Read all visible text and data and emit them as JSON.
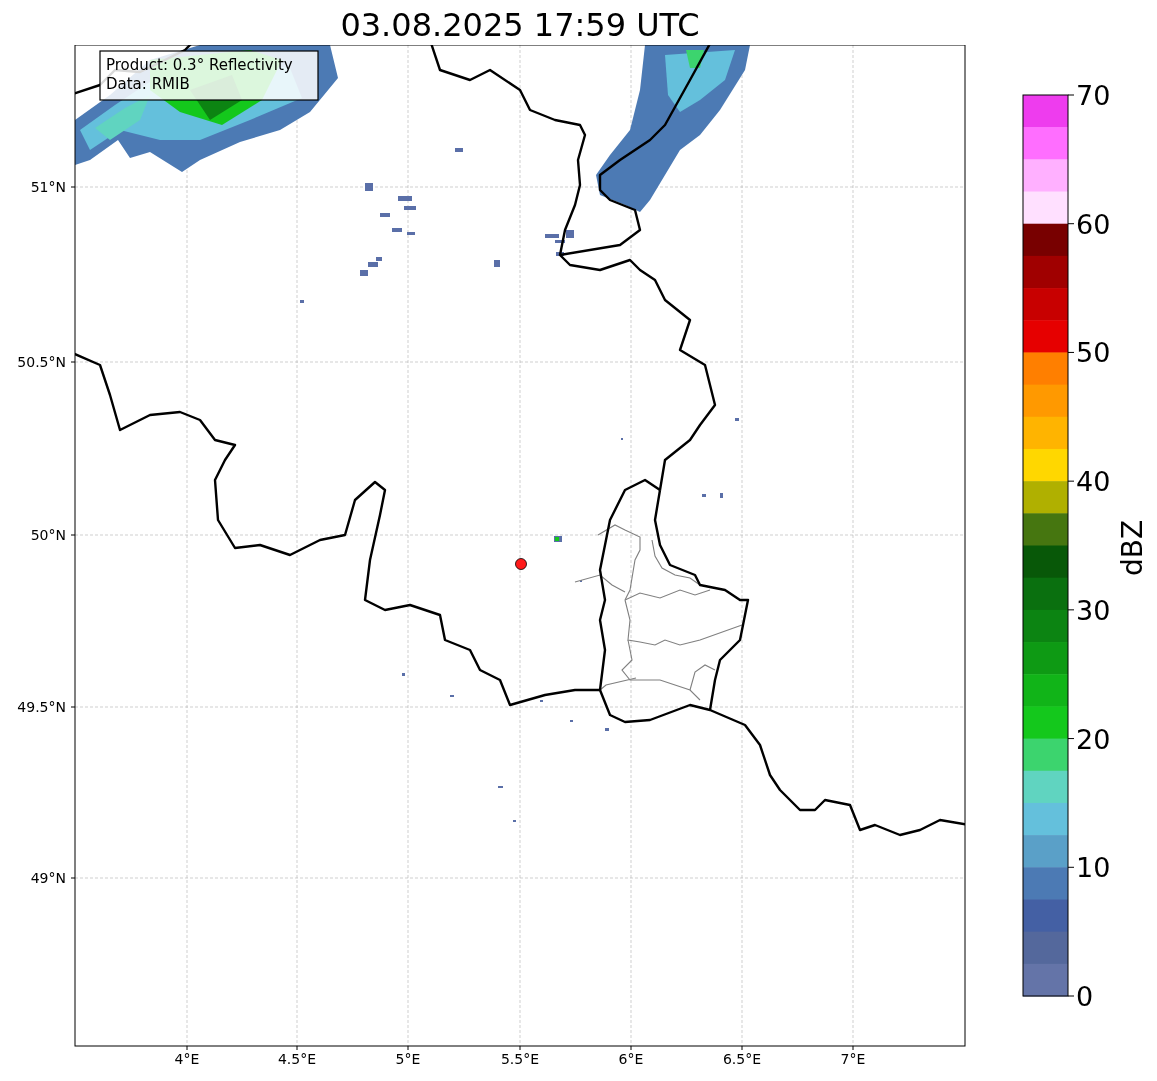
{
  "title": "03.08.2025 17:59 UTC",
  "info_box": {
    "lines": [
      "Product: 0.3° Reflectivity",
      "Data: RMIB"
    ]
  },
  "map": {
    "lat_ticks": [
      "51°N",
      "50.5°N",
      "50°N",
      "49.5°N",
      "49°N"
    ],
    "lon_ticks": [
      "4°E",
      "4.5°E",
      "5°E",
      "5.5°E",
      "6°E",
      "6.5°E",
      "7°E"
    ]
  },
  "colorbar": {
    "label": "dBZ",
    "ticks": [
      "70",
      "60",
      "50",
      "40",
      "30",
      "20",
      "10",
      "0"
    ],
    "bins": [
      {
        "color": "#ee3cee"
      },
      {
        "color": "#ff6eff"
      },
      {
        "color": "#ffb0ff"
      },
      {
        "color": "#ffe0ff"
      },
      {
        "color": "#780000"
      },
      {
        "color": "#a00000"
      },
      {
        "color": "#c80000"
      },
      {
        "color": "#e60000"
      },
      {
        "color": "#ff7f00"
      },
      {
        "color": "#ff9900"
      },
      {
        "color": "#ffb400"
      },
      {
        "color": "#ffd700"
      },
      {
        "color": "#b0b000"
      },
      {
        "color": "#467610"
      },
      {
        "color": "#085808"
      },
      {
        "color": "#0a700f"
      },
      {
        "color": "#0c8412"
      },
      {
        "color": "#0e9a14"
      },
      {
        "color": "#11b418"
      },
      {
        "color": "#14c81c"
      },
      {
        "color": "#3cd46e"
      },
      {
        "color": "#60d4c0"
      },
      {
        "color": "#64c0dc"
      },
      {
        "color": "#5aa0c8"
      },
      {
        "color": "#4c7ab4"
      },
      {
        "color": "#4460a4"
      },
      {
        "color": "#54689c"
      },
      {
        "color": "#6474a8"
      }
    ]
  }
}
